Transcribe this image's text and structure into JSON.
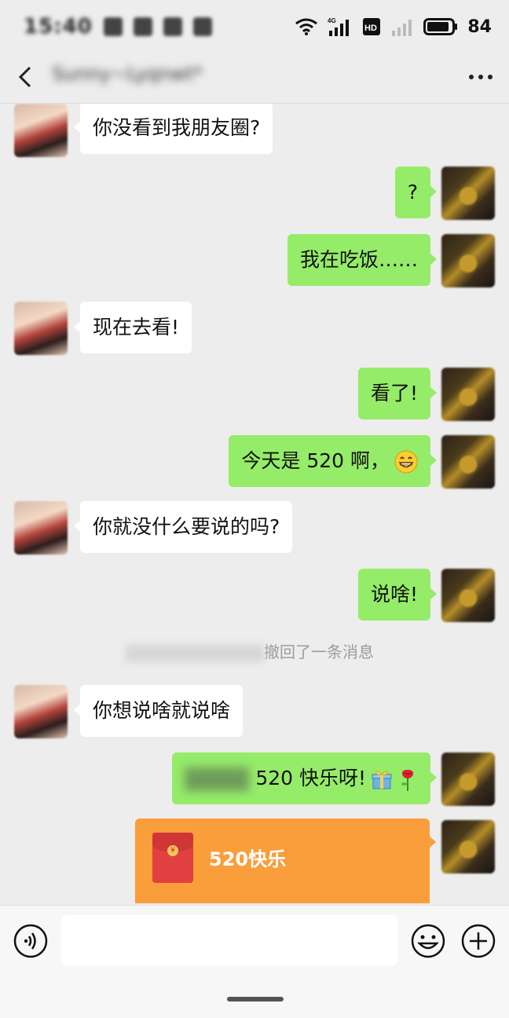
{
  "status_bar": {
    "time": "15:40",
    "battery": "84",
    "network": "4G",
    "hd": "HD"
  },
  "header": {
    "title": "Sunny~Lyqnwt*"
  },
  "messages": [
    {
      "side": "left",
      "text": "你没看到我朋友圈?"
    },
    {
      "side": "right",
      "text": "?"
    },
    {
      "side": "right",
      "text": "我在吃饭……"
    },
    {
      "side": "left",
      "text": "现在去看!"
    },
    {
      "side": "right",
      "text": "看了!"
    },
    {
      "side": "right",
      "text": "今天是 520 啊，",
      "emoji": "grin-emoji"
    },
    {
      "side": "left",
      "text": "你就没什么要说的吗?"
    },
    {
      "side": "right",
      "text": "说啥!"
    },
    {
      "side": "left",
      "text": "你想说啥就说啥"
    },
    {
      "side": "right",
      "text": "520 快乐呀!",
      "emoji": [
        "gift-emoji",
        "rose-emoji"
      ]
    }
  ],
  "recall_notice": {
    "text": "撤回了一条消息"
  },
  "red_packet": {
    "label": "520快乐",
    "coin": "¥"
  },
  "input_bar": {
    "placeholder": "",
    "icons": [
      "voice-icon",
      "emoji-icon",
      "plus-icon"
    ]
  },
  "colors": {
    "background": "#ededed",
    "bubble_self": "#95ec69",
    "bubble_other": "#ffffff",
    "red_packet": "#fa9d3b"
  }
}
